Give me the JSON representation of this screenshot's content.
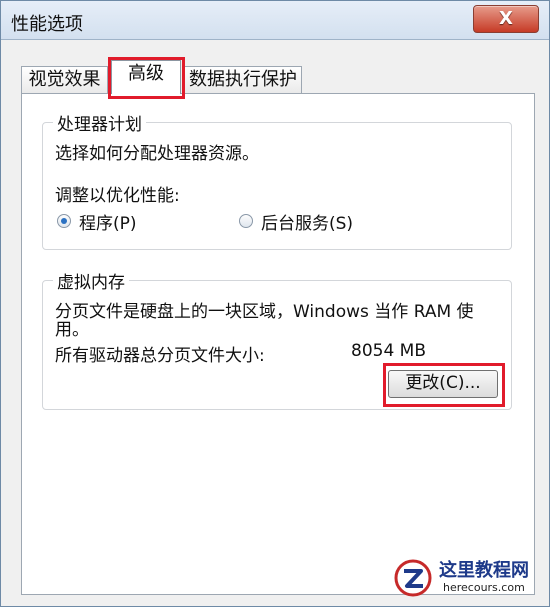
{
  "window": {
    "title": "性能选项",
    "close_glyph": "X"
  },
  "tabs": [
    {
      "label": "视觉效果"
    },
    {
      "label": "高级",
      "active": true
    },
    {
      "label": "数据执行保护"
    }
  ],
  "processor": {
    "group_label": "处理器计划",
    "description": "选择如何分配处理器资源。",
    "adjust_label": "调整以优化性能:",
    "options": [
      {
        "label": "程序(P)",
        "selected": true
      },
      {
        "label": "后台服务(S)",
        "selected": false
      }
    ]
  },
  "virtual_memory": {
    "group_label": "虚拟内存",
    "description_line1": "分页文件是硬盘上的一块区域，Windows 当作 RAM 使",
    "description_line2": "用。",
    "total_label": "所有驱动器总分页文件大小:",
    "total_value": "8054 MB",
    "change_button": "更改(C)..."
  },
  "watermark": {
    "cn": "这里教程网",
    "en": "herecours.com"
  },
  "colors": {
    "highlight": "#e11b2b",
    "close_button": "#c63b26"
  }
}
